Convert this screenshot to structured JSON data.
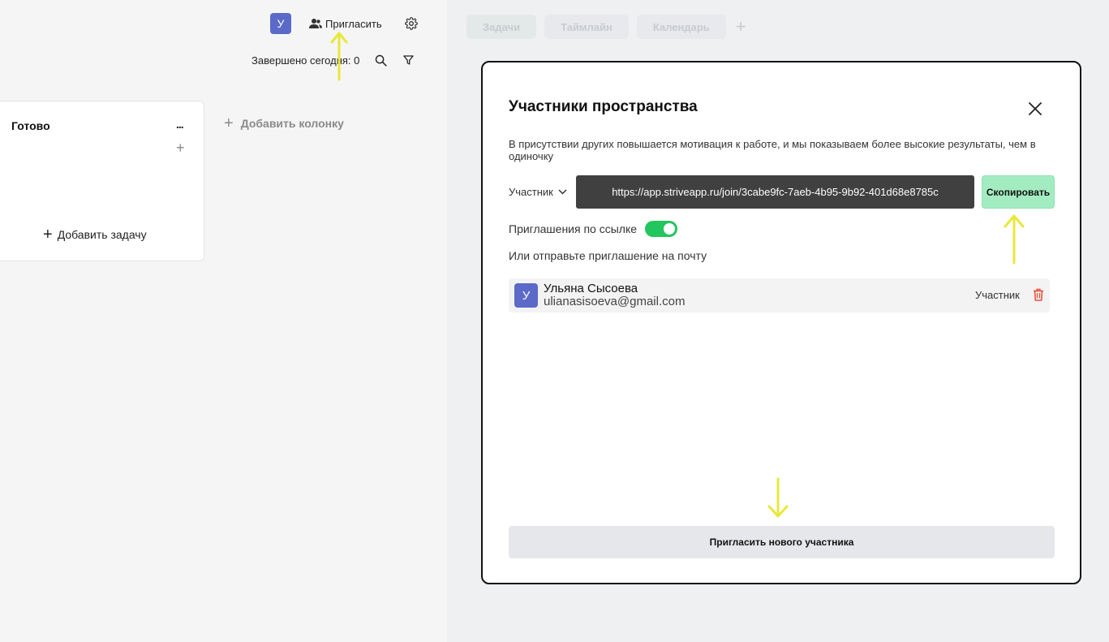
{
  "header": {
    "avatar_letter": "У",
    "invite_label": "Пригласить",
    "done_today_label": "Завершено сегодня: 0"
  },
  "board": {
    "column_title": "Готово",
    "column_more": "...",
    "column_add": "+",
    "add_task_icon": "+",
    "add_task_label": "Добавить задачу",
    "add_column_icon": "+",
    "add_column_label": "Добавить колонку"
  },
  "view_tabs": {
    "items": [
      {
        "label": "Задачи"
      },
      {
        "label": "Таймлайн"
      },
      {
        "label": "Календарь"
      }
    ],
    "add_label": "+"
  },
  "modal": {
    "title": "Участники пространства",
    "description": "В присутствии других повышается мотивация к работе, и мы показываем более высокие результаты, чем в одиночку",
    "role_label": "Участник",
    "invite_url": "https://app.striveapp.ru/join/3cabe9fc-7aeb-4b95-9b92-401d68e8785c",
    "copy_label": "Скопировать",
    "link_invites_label": "Приглашения по ссылке",
    "link_invites_enabled": true,
    "email_hint": "Или отправьте приглашение на почту",
    "members": [
      {
        "avatar": "У",
        "name": "Ульяна Сысоева",
        "email": "ulianasisoeva@gmail.com",
        "role": "Участник"
      }
    ],
    "invite_new_label": "Пригласить нового участника"
  },
  "colors": {
    "accent_green": "#22c55e",
    "copy_button": "#a3ecc2",
    "avatar": "#5b6ac9",
    "annotation_arrow": "#e8e83a",
    "delete_icon": "#e5533d"
  },
  "icons": [
    "users-icon",
    "gear-icon",
    "search-icon",
    "filter-icon",
    "close-icon",
    "chevron-down-icon",
    "trash-icon",
    "arrow-annotation-icon"
  ]
}
